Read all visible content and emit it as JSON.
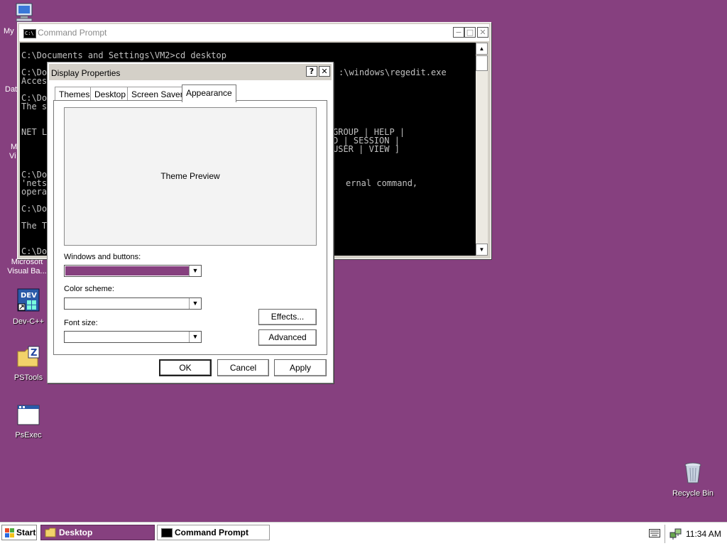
{
  "desktop": {
    "background_color": "#86407f",
    "icons": [
      {
        "name": "my-computer",
        "label": "My",
        "icon": "computer-icon"
      },
      {
        "name": "data-partial",
        "label": "Dat"
      },
      {
        "name": "ms-partial",
        "label": "M"
      },
      {
        "name": "vi-partial",
        "label": "Vi"
      },
      {
        "name": "vb6",
        "label": "Microsoft Visual Ba..."
      },
      {
        "name": "devcpp",
        "label": "Dev-C++",
        "icon": "devcpp-icon"
      },
      {
        "name": "pstools",
        "label": "PSTools",
        "icon": "folder-zip-icon"
      },
      {
        "name": "psexec",
        "label": "PsExec",
        "icon": "app-window-icon"
      },
      {
        "name": "recycle-bin",
        "label": "Recycle Bin",
        "icon": "recycle-bin-icon"
      }
    ]
  },
  "cmd_window": {
    "title": "Command Prompt",
    "icon_text": "C:\\",
    "lines": [
      "C:\\Documents and Settings\\VM2>cd desktop",
      "C:\\Do",
      "Acces",
      "C:\\Do",
      "The s",
      "NET L",
      "C:\\Do",
      "'nets",
      "opera",
      "C:\\Do",
      "The T",
      "C:\\Do"
    ],
    "right_lines": [
      ":\\windows\\regedit.exe",
      "GROUP | HELP |",
      "D | SESSION |",
      "USER | VIEW ]",
      "ernal command,"
    ]
  },
  "dialog": {
    "title": "Display Properties",
    "help_button": "?",
    "close_button": "✕",
    "tabs": [
      "Themes",
      "Desktop",
      "Screen Saver",
      "Appearance"
    ],
    "active_tab": "Appearance",
    "preview_text": "Theme Preview",
    "windows_buttons_label": "Windows and buttons:",
    "windows_buttons_color": "#86407f",
    "color_scheme_label": "Color scheme:",
    "font_size_label": "Font size:",
    "effects_button": "Effects...",
    "advanced_button": "Advanced",
    "ok_button": "OK",
    "cancel_button": "Cancel",
    "apply_button": "Apply"
  },
  "taskbar": {
    "start_label": "Start",
    "tasks": [
      {
        "label": "Desktop",
        "icon": "folder-icon",
        "active": true
      },
      {
        "label": "Command Prompt",
        "icon": "cmd-icon",
        "active": false
      }
    ],
    "clock": "11:34 AM",
    "tray_icons": [
      "keyboard-icon",
      "network-icon"
    ]
  }
}
